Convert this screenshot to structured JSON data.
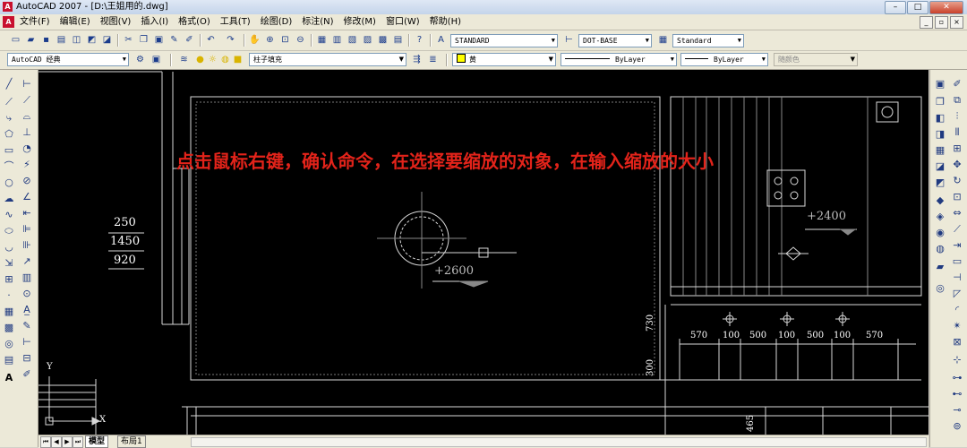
{
  "window": {
    "title": "AutoCAD 2007 - [D:\\王姐用的.dwg]",
    "app_icon": "autocad-logo",
    "controls": [
      "minimize",
      "maximize",
      "close"
    ]
  },
  "menu": {
    "items": [
      "文件(F)",
      "编辑(E)",
      "视图(V)",
      "插入(I)",
      "格式(O)",
      "工具(T)",
      "绘图(D)",
      "标注(N)",
      "修改(M)",
      "窗口(W)",
      "帮助(H)"
    ],
    "doc_controls": [
      "minimize",
      "restore",
      "close"
    ]
  },
  "styles_toolbar": {
    "text_style": "STANDARD",
    "dim_style": "DOT-BASE",
    "table_style": "Standard"
  },
  "properties_toolbar": {
    "workspace": "AutoCAD 经典",
    "layer": "柱子填充",
    "color": "黄",
    "linetype": "ByLayer",
    "lineweight": "ByLayer",
    "plot_style": "随颜色"
  },
  "annotation": {
    "text": "点击鼠标右键，确认命令，在选择要缩放的对象，在输入缩放的大小",
    "color": "#e2231a"
  },
  "drawing": {
    "left_dims": [
      "250",
      "1450",
      "920"
    ],
    "center_level": "+2600",
    "right_level": "+2400",
    "vertical_dims": [
      "730",
      "300",
      "465"
    ],
    "bottom_dims": [
      "570",
      "100",
      "500",
      "100",
      "500",
      "100",
      "570"
    ],
    "ucs_y": "Y",
    "ucs_x": "X"
  },
  "tabs": [
    "模型",
    "布局1"
  ],
  "colors": {
    "canvas_bg": "#000000",
    "toolbar_bg": "#ece9d8",
    "annotation": "#e2231a"
  }
}
